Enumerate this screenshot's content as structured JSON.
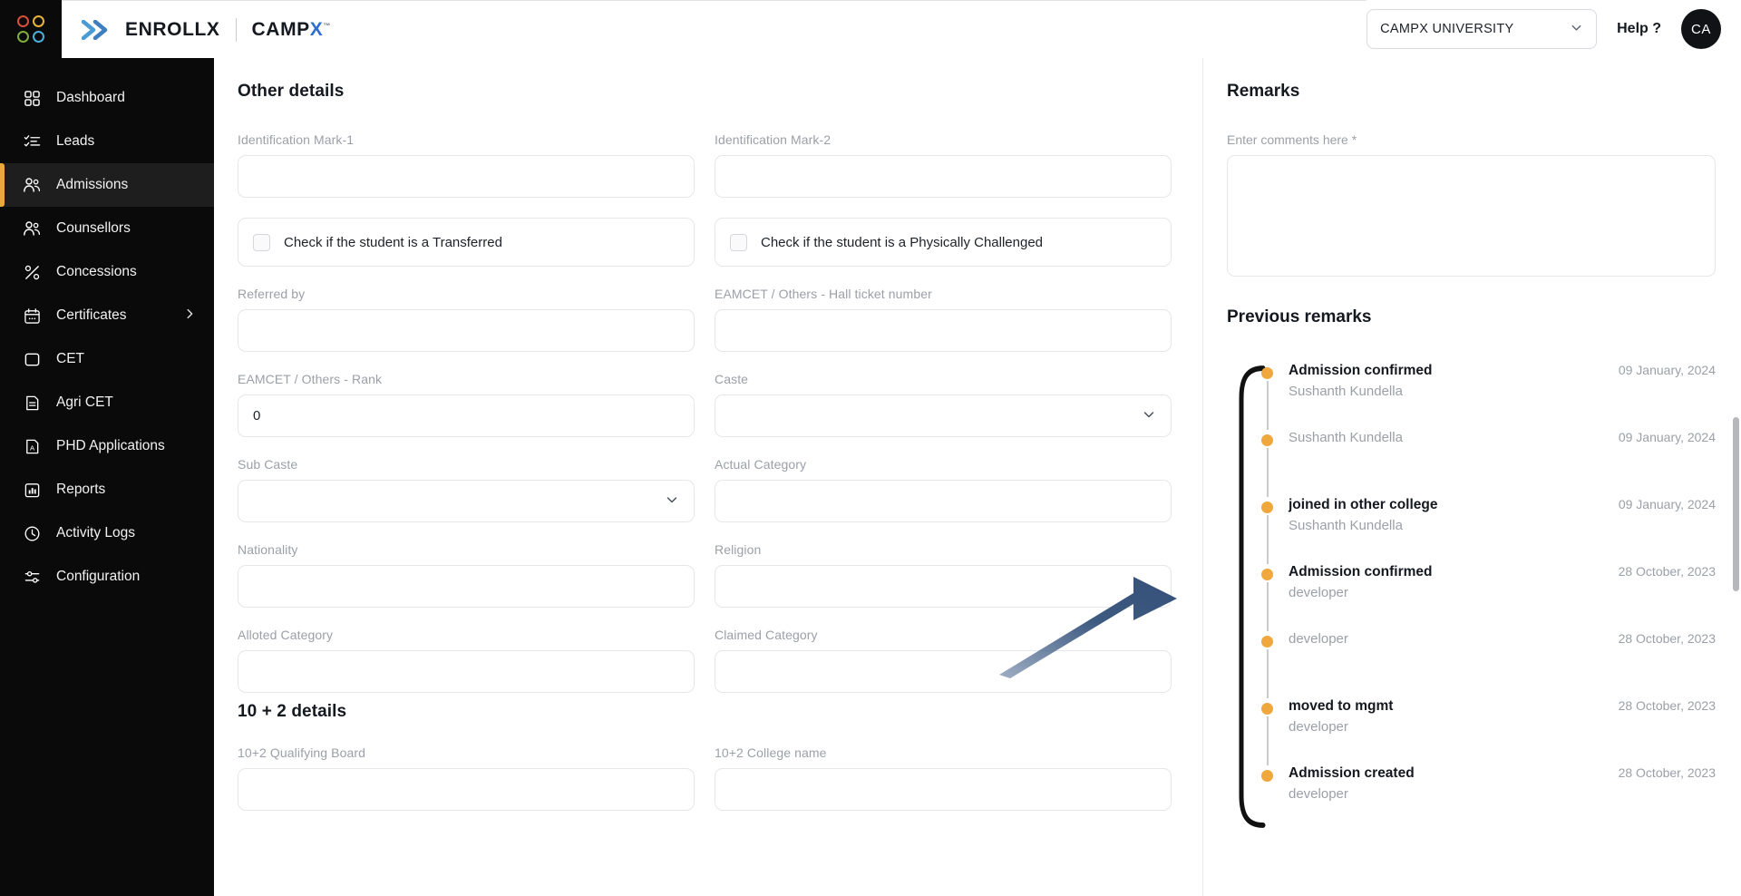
{
  "header": {
    "logo_icon": "four-dots-grid-icon",
    "logo_colors": [
      "#d6503c",
      "#e8b23a",
      "#7fae3f",
      "#4aaed9"
    ],
    "brand_primary": "ENROLLX",
    "brand_secondary_main": "CAMP",
    "brand_secondary_accent": "X",
    "brand_accent_color": "#2f6fd0",
    "university_select_value": "CAMPX UNIVERSITY",
    "help_label": "Help ?",
    "avatar_initials": "CA"
  },
  "sidebar": {
    "items": [
      {
        "label": "Dashboard",
        "icon": "grid-dashboard-icon",
        "active": false,
        "has_chevron": false
      },
      {
        "label": "Leads",
        "icon": "checklist-icon",
        "active": false,
        "has_chevron": false
      },
      {
        "label": "Admissions",
        "icon": "users-icon",
        "active": true,
        "has_chevron": false
      },
      {
        "label": "Counsellors",
        "icon": "users-icon",
        "active": false,
        "has_chevron": false
      },
      {
        "label": "Concessions",
        "icon": "percent-discount-icon",
        "active": false,
        "has_chevron": false
      },
      {
        "label": "Certificates",
        "icon": "calendar-icon",
        "active": false,
        "has_chevron": true
      },
      {
        "label": "CET",
        "icon": "square-icon",
        "active": false,
        "has_chevron": false
      },
      {
        "label": "Agri CET",
        "icon": "document-lines-icon",
        "active": false,
        "has_chevron": false
      },
      {
        "label": "PHD Applications",
        "icon": "document-a-icon",
        "active": false,
        "has_chevron": false
      },
      {
        "label": "Reports",
        "icon": "bar-chart-icon",
        "active": false,
        "has_chevron": false
      },
      {
        "label": "Activity Logs",
        "icon": "clock-icon",
        "active": false,
        "has_chevron": false
      },
      {
        "label": "Configuration",
        "icon": "sliders-icon",
        "active": false,
        "has_chevron": false
      }
    ],
    "active_indicator_color": "#eda83b"
  },
  "main": {
    "section_title": "Other details",
    "fields": [
      {
        "label": "Identification Mark-1",
        "value": "",
        "type": "text"
      },
      {
        "label": "Identification Mark-2",
        "value": "",
        "type": "text"
      }
    ],
    "checkboxes": [
      {
        "label": "Check if the student is a Transferred",
        "checked": false
      },
      {
        "label": "Check if the student is a Physically Challenged",
        "checked": false
      }
    ],
    "fields2": [
      {
        "label": "Referred by",
        "value": "",
        "type": "text"
      },
      {
        "label": "EAMCET / Others - Hall ticket number",
        "value": "",
        "type": "text"
      },
      {
        "label": "EAMCET / Others - Rank",
        "value": "0",
        "type": "text"
      },
      {
        "label": "Caste",
        "value": "",
        "type": "select"
      },
      {
        "label": "Sub Caste",
        "value": "",
        "type": "select"
      },
      {
        "label": "Actual Category",
        "value": "",
        "type": "text"
      },
      {
        "label": "Nationality",
        "value": "",
        "type": "text"
      },
      {
        "label": "Religion",
        "value": "",
        "type": "text"
      },
      {
        "label": "Alloted Category",
        "value": "",
        "type": "text"
      },
      {
        "label": "Claimed Category",
        "value": "",
        "type": "text"
      }
    ],
    "section_title_2": "10 + 2 details",
    "fields3": [
      {
        "label": "10+2 Qualifying Board",
        "value": "",
        "type": "text"
      },
      {
        "label": "10+2 College name",
        "value": "",
        "type": "text"
      }
    ]
  },
  "remarks": {
    "title": "Remarks",
    "comments_label": "Enter comments here",
    "comments_required_marker": "*",
    "comments_value": "",
    "previous_title": "Previous remarks",
    "dot_color": "#f0a83e",
    "entries": [
      {
        "heading": "Admission confirmed",
        "user": "Sushanth Kundella",
        "date": "09 January, 2024"
      },
      {
        "heading": "",
        "user": "Sushanth Kundella",
        "date": "09 January, 2024"
      },
      {
        "heading": "joined in other college",
        "user": "Sushanth Kundella",
        "date": "09 January, 2024"
      },
      {
        "heading": "Admission confirmed",
        "user": "developer",
        "date": "28 October, 2023"
      },
      {
        "heading": "",
        "user": "developer",
        "date": "28 October, 2023"
      },
      {
        "heading": "moved to mgmt",
        "user": "developer",
        "date": "28 October, 2023"
      },
      {
        "heading": "Admission created",
        "user": "developer",
        "date": "28 October, 2023"
      }
    ]
  },
  "annotation": {
    "type": "pointer-arrow",
    "color": "#3d5a80"
  }
}
